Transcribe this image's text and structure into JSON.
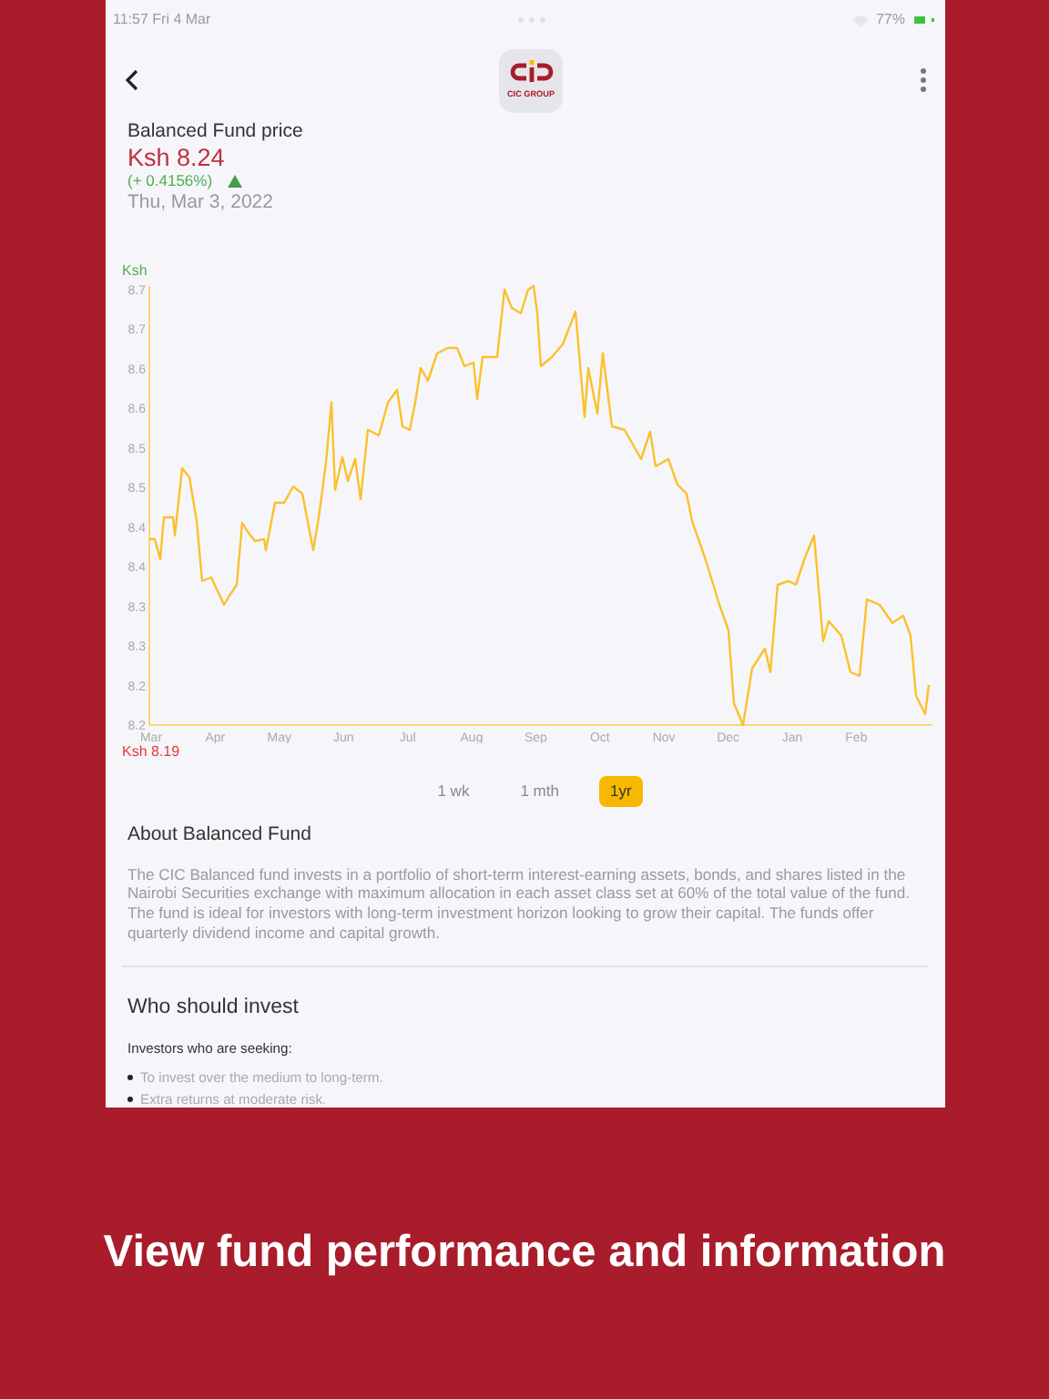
{
  "status_bar": {
    "time": "11:57 Fri 4 Mar",
    "battery": "77%"
  },
  "header": {
    "logo_text": "CIC GROUP"
  },
  "price": {
    "title": "Balanced Fund price",
    "value": "Ksh 8.24",
    "change": "(+ 0.4156%)",
    "date": "Thu, Mar 3, 2022"
  },
  "chart": {
    "unit_label": "Ksh",
    "min_label": "Ksh 8.19",
    "y_labels": [
      "8.7",
      "8.7",
      "8.6",
      "8.6",
      "8.5",
      "8.5",
      "8.4",
      "8.4",
      "8.3",
      "8.3",
      "8.2",
      "8.2"
    ],
    "x_labels": [
      "Mar",
      "Apr",
      "May",
      "Jun",
      "Jul",
      "Aug",
      "Sep",
      "Oct",
      "Nov",
      "Dec",
      "Jan",
      "Feb"
    ]
  },
  "ranges": [
    {
      "label": "1 wk",
      "selected": false
    },
    {
      "label": "1 mth",
      "selected": false
    },
    {
      "label": "1yr",
      "selected": true
    }
  ],
  "about": {
    "title": "About Balanced Fund",
    "body": "The CIC Balanced fund invests in a portfolio of short-term interest-earning assets, bonds, and shares listed in the Nairobi Securities exchange with maximum allocation in each asset class set at 60% of the total value of the fund. The fund is ideal for investors with long-term investment horizon looking to grow their capital.  The funds offer quarterly  dividend income and capital growth."
  },
  "who": {
    "title": "Who should invest",
    "intro": "Investors who are seeking:",
    "bullets": [
      "To invest over the medium to long-term.",
      "Extra returns at moderate risk."
    ]
  },
  "caption": "View fund performance and information"
}
